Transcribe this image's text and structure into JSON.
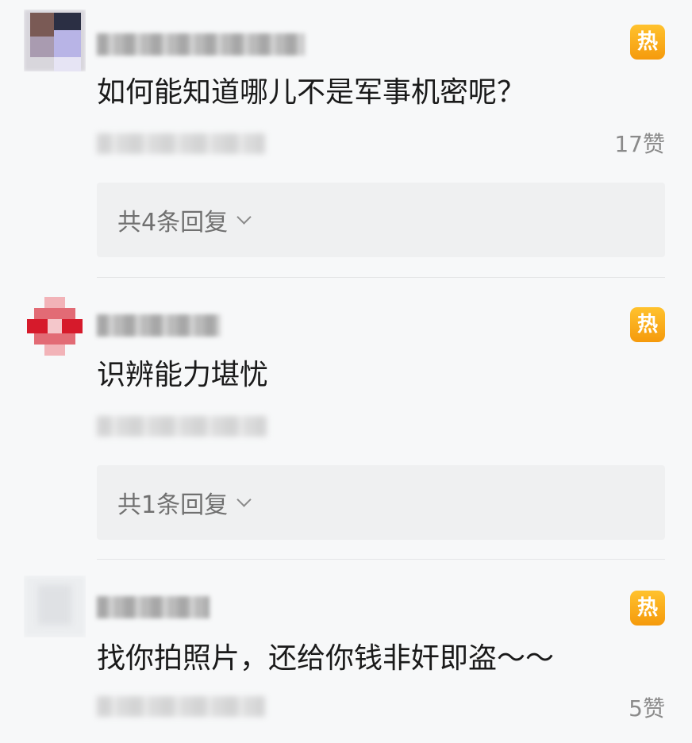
{
  "colors": {
    "hot_badge": "#f5a81a",
    "background": "#f7f8f9",
    "reply_box": "#eff0f1"
  },
  "comments": [
    {
      "avatar_icon": "user-avatar-icon",
      "text": "如何能知道哪儿不是军事机密呢？",
      "hot_label": "热",
      "likes": "17赞",
      "replies": "共4条回复"
    },
    {
      "avatar_icon": "user-avatar-icon",
      "text": "识辨能力堪忧",
      "hot_label": "热",
      "likes": "",
      "replies": "共1条回复"
    },
    {
      "avatar_icon": "user-avatar-icon",
      "text": "找你拍照片，还给你钱非奸即盗～～",
      "hot_label": "热",
      "likes": "5赞",
      "replies": ""
    }
  ]
}
